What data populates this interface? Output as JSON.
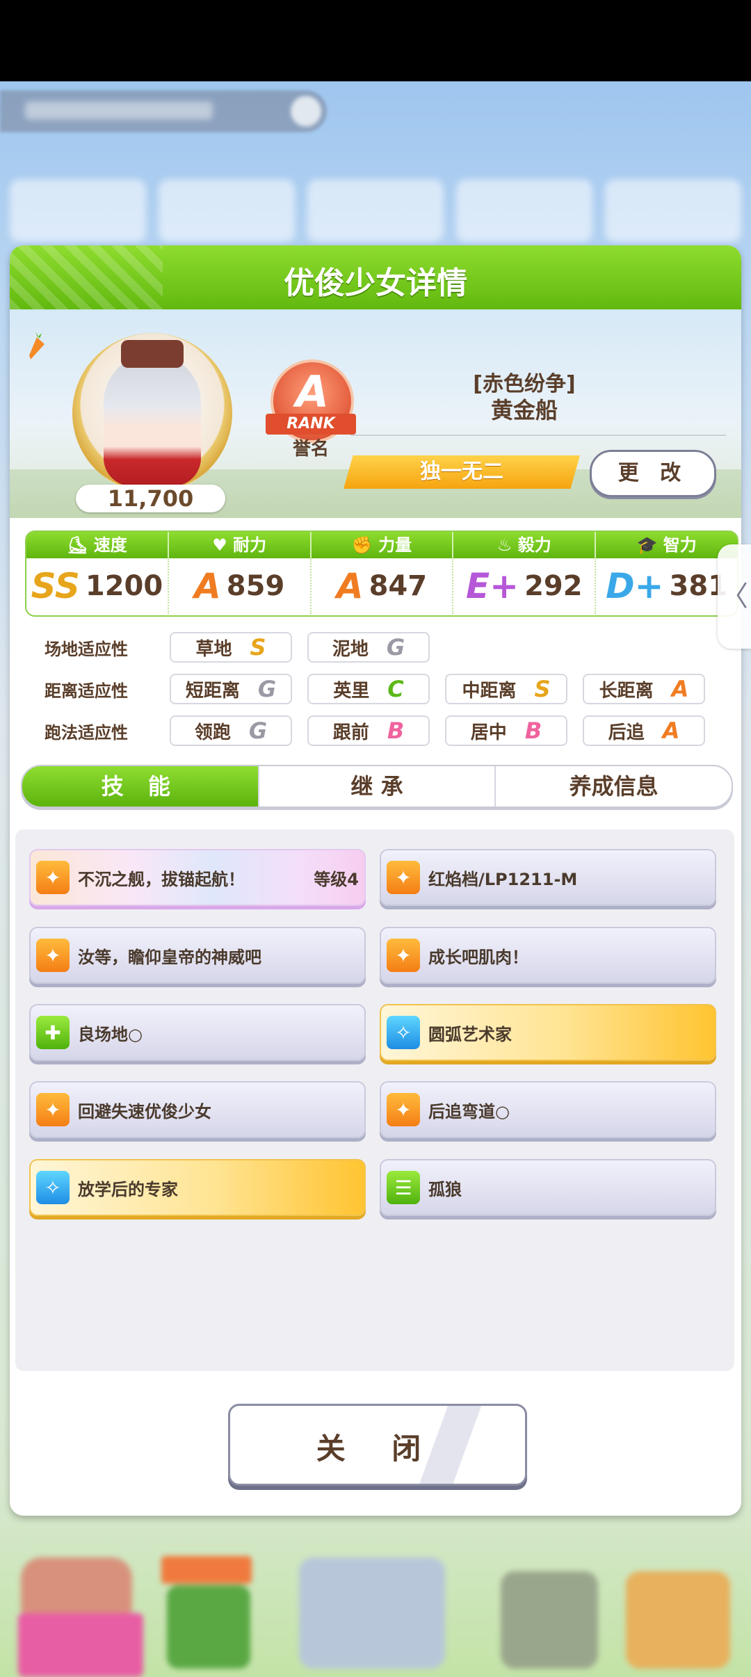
{
  "panel": {
    "title": "优俊少女详情",
    "score": "11,700",
    "rank": {
      "letter": "A",
      "ribbon": "RANK",
      "label": "誉名"
    },
    "title_tag": "[赤色纷争]",
    "character_name": "黄金船",
    "unique_title": "独一无二",
    "change_button": "更 改"
  },
  "stats": [
    {
      "label": "速度",
      "grade": "SS",
      "grade_color": "#e7a51b",
      "value": "1200",
      "icon": "shoe-icon"
    },
    {
      "label": "耐力",
      "grade": "A",
      "grade_color": "#f07c22",
      "value": "859",
      "icon": "heart-icon"
    },
    {
      "label": "力量",
      "grade": "A",
      "grade_color": "#f07c22",
      "value": "847",
      "icon": "muscle-icon"
    },
    {
      "label": "毅力",
      "grade": "E+",
      "grade_color": "#b657d8",
      "value": "292",
      "icon": "flame-icon"
    },
    {
      "label": "智力",
      "grade": "D+",
      "grade_color": "#3aa8e8",
      "value": "381",
      "icon": "graduation-cap-icon"
    }
  ],
  "aptitude": {
    "track": {
      "label": "场地适应性",
      "items": [
        {
          "name": "草地",
          "grade": "S",
          "color": "#e7a51b"
        },
        {
          "name": "泥地",
          "grade": "G",
          "color": "#9a9aa5"
        }
      ]
    },
    "distance": {
      "label": "距离适应性",
      "items": [
        {
          "name": "短距离",
          "grade": "G",
          "color": "#9a9aa5"
        },
        {
          "name": "英里",
          "grade": "C",
          "color": "#5cb816"
        },
        {
          "name": "中距离",
          "grade": "S",
          "color": "#e7a51b"
        },
        {
          "name": "长距离",
          "grade": "A",
          "color": "#f07c22"
        }
      ]
    },
    "style": {
      "label": "跑法适应性",
      "items": [
        {
          "name": "领跑",
          "grade": "G",
          "color": "#9a9aa5"
        },
        {
          "name": "跟前",
          "grade": "B",
          "color": "#f0639e"
        },
        {
          "name": "居中",
          "grade": "B",
          "color": "#f0639e"
        },
        {
          "name": "后追",
          "grade": "A",
          "color": "#f07c22"
        }
      ]
    }
  },
  "tabs": [
    "技 能",
    "继 承",
    "养成信息"
  ],
  "skills": [
    {
      "name": "不沉之舰，拔锚起航！",
      "level": "等级4",
      "style": "rainbow",
      "icon": "ico-orange"
    },
    {
      "name": "红焰档/LP1211-M",
      "level": "",
      "style": "normal",
      "icon": "ico-orange"
    },
    {
      "name": "汝等，瞻仰皇帝的神威吧",
      "level": "",
      "style": "normal",
      "icon": "ico-orange"
    },
    {
      "name": "成长吧肌肉！",
      "level": "",
      "style": "normal",
      "icon": "ico-orange"
    },
    {
      "name": "良场地○",
      "level": "",
      "style": "normal",
      "icon": "ico-green"
    },
    {
      "name": "圆弧艺术家",
      "level": "",
      "style": "gold",
      "icon": "ico-blue"
    },
    {
      "name": "回避失速优俊少女",
      "level": "",
      "style": "normal",
      "icon": "ico-orange"
    },
    {
      "name": "后追弯道○",
      "level": "",
      "style": "normal",
      "icon": "ico-orange"
    },
    {
      "name": "放学后的专家",
      "level": "",
      "style": "gold",
      "icon": "ico-blue"
    },
    {
      "name": "孤狼",
      "level": "",
      "style": "normal",
      "icon": "ico-green"
    }
  ],
  "close_button": "关 闭",
  "side_tab": "〈"
}
